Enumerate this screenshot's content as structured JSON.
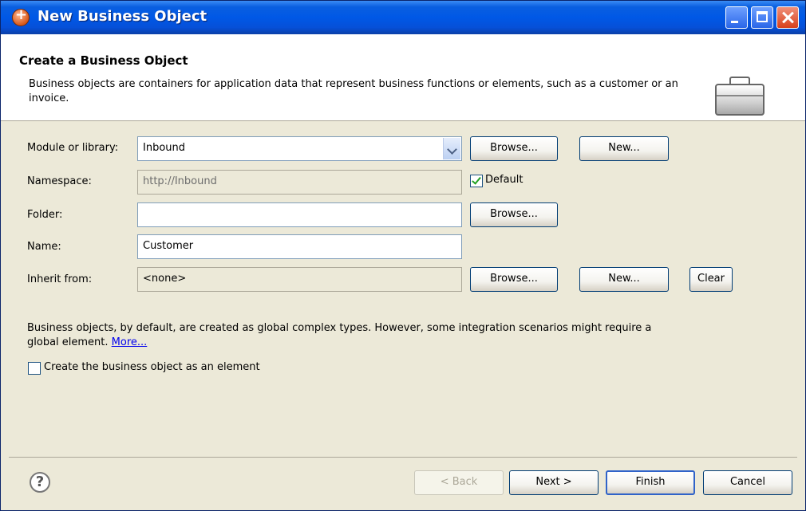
{
  "window": {
    "title": "New Business Object"
  },
  "header": {
    "title": "Create a Business Object",
    "description": "Business objects are containers for application data that represent business functions or elements, such as a customer or an invoice.",
    "icon": "briefcase-icon"
  },
  "form": {
    "module_label": "Module or library:",
    "module_value": "Inbound",
    "namespace_label": "Namespace:",
    "namespace_value": "http://Inbound",
    "default_label": "Default",
    "default_checked": true,
    "folder_label": "Folder:",
    "folder_value": "",
    "name_label": "Name:",
    "name_value": "Customer",
    "inherit_label": "Inherit from:",
    "inherit_value": "<none>"
  },
  "buttons": {
    "browse": "Browse...",
    "new": "New...",
    "clear": "Clear",
    "back": "< Back",
    "next": "Next >",
    "finish": "Finish",
    "cancel": "Cancel"
  },
  "info": {
    "text": "Business objects, by default, are created as global complex types. However, some integration scenarios might require a global element.",
    "more_link": "More...",
    "element_checkbox_label": "Create the business object as an element",
    "element_checked": false
  },
  "help": {
    "symbol": "?"
  }
}
